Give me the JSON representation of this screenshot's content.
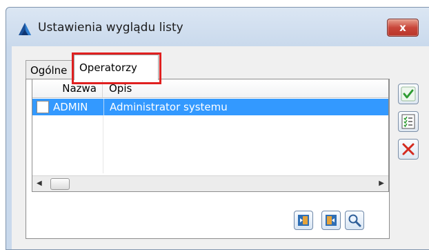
{
  "window": {
    "title": "Ustawienia wyglądu listy",
    "close_label": "x"
  },
  "tabs": [
    {
      "label": "Ogólne"
    },
    {
      "label": "Operatorzy"
    }
  ],
  "grid": {
    "columns": [
      "Nazwa",
      "Opis"
    ],
    "rows": [
      {
        "nazwa": "ADMIN",
        "opis": "Administrator systemu",
        "checked": false
      }
    ]
  },
  "colors": {
    "selection": "#3399ff",
    "highlight": "#e02020"
  },
  "icons": {
    "side": [
      "check-icon",
      "checklist-icon",
      "delete-x-icon"
    ],
    "bottom": [
      "dock-left-icon",
      "dock-right-icon",
      "search-icon"
    ]
  }
}
